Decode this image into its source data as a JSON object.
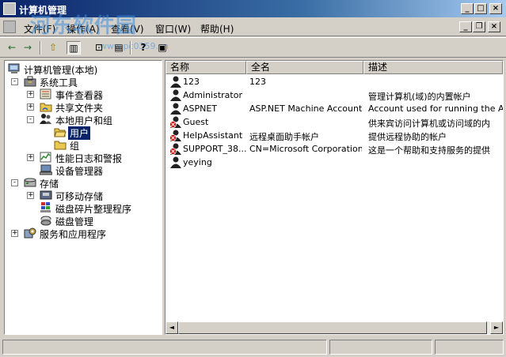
{
  "window": {
    "title": "计算机管理",
    "controls": {
      "minimize": "_",
      "maximize": "□",
      "close": "×"
    },
    "child_controls": {
      "minimize": "_",
      "restore": "❐",
      "close": "×"
    }
  },
  "watermark": {
    "text": "河东软件园",
    "url": "www.pc0359.cn"
  },
  "menu": {
    "items": [
      {
        "label": "文件(F)"
      },
      {
        "label": "操作(A)"
      },
      {
        "label": "查看(V)"
      },
      {
        "label": "窗口(W)"
      },
      {
        "label": "帮助(H)"
      }
    ]
  },
  "toolbar": {
    "buttons": [
      {
        "icon": "back-arrow-icon",
        "glyph": "←"
      },
      {
        "icon": "forward-arrow-icon",
        "glyph": "→"
      },
      {
        "icon": "up-folder-icon",
        "glyph": "⇧"
      },
      {
        "icon": "show-tree-icon",
        "glyph": "▥"
      },
      {
        "icon": "export-list-icon",
        "glyph": "⊡"
      },
      {
        "icon": "properties-icon",
        "glyph": "▤"
      },
      {
        "icon": "help-icon",
        "glyph": "?"
      },
      {
        "icon": "console-icon",
        "glyph": "▣"
      }
    ]
  },
  "tree": {
    "items": [
      {
        "label": "计算机管理(本地)",
        "expander": "-"
      },
      {
        "label": "系统工具",
        "expander": "-"
      },
      {
        "label": "事件查看器",
        "expander": "+"
      },
      {
        "label": "共享文件夹",
        "expander": "+"
      },
      {
        "label": "本地用户和组",
        "expander": "-"
      },
      {
        "label": "用户",
        "expander": "",
        "selected": true
      },
      {
        "label": "组",
        "expander": ""
      },
      {
        "label": "性能日志和警报",
        "expander": "+"
      },
      {
        "label": "设备管理器",
        "expander": ""
      },
      {
        "label": "存储",
        "expander": "-"
      },
      {
        "label": "可移动存储",
        "expander": "+"
      },
      {
        "label": "磁盘碎片整理程序",
        "expander": ""
      },
      {
        "label": "磁盘管理",
        "expander": ""
      },
      {
        "label": "服务和应用程序",
        "expander": "+"
      }
    ]
  },
  "list": {
    "columns": [
      "名称",
      "全名",
      "描述"
    ],
    "rows": [
      {
        "name": "123",
        "fullname": "123",
        "description": "",
        "disabled": false
      },
      {
        "name": "Administrator",
        "fullname": "",
        "description": "管理计算机(域)的内置帐户",
        "disabled": false
      },
      {
        "name": "ASPNET",
        "fullname": "ASP.NET Machine Account",
        "description": "Account used for running the ASP.I",
        "disabled": false
      },
      {
        "name": "Guest",
        "fullname": "",
        "description": "供来宾访问计算机或访问域的内",
        "disabled": true
      },
      {
        "name": "HelpAssistant",
        "fullname": "远程桌面助手帐户",
        "description": "提供远程协助的帐户",
        "disabled": true
      },
      {
        "name": "SUPPORT_38...",
        "fullname": "CN=Microsoft Corporation...",
        "description": "这是一个帮助和支持服务的提供",
        "disabled": true
      },
      {
        "name": "yeying",
        "fullname": "",
        "description": "",
        "disabled": false
      }
    ]
  },
  "scrollbar": {
    "left": "◄",
    "right": "►"
  },
  "colors": {
    "title_start": "#0a246a",
    "title_end": "#a6caf0",
    "selection": "#0a246a",
    "disabled_mark": "#d40000"
  }
}
